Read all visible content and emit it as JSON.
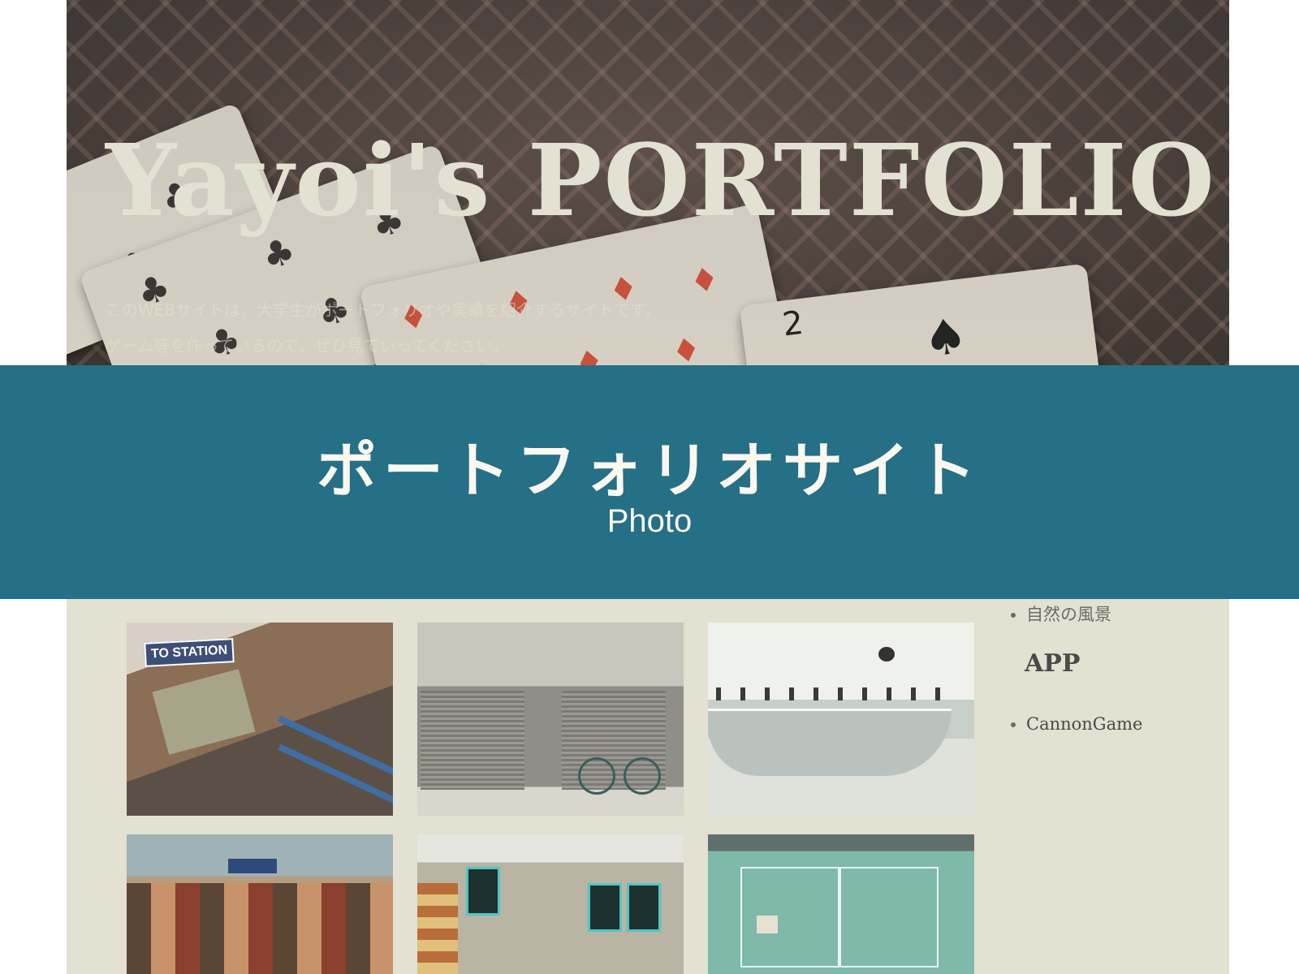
{
  "hero": {
    "title": "Yayoi's PORTFOLIO",
    "description": [
      "このWEBサイトは、大学生がポートフォリオや実績を紹介するサイトです。",
      "ゲーム等を作っているので、ぜひ見ていってください。"
    ]
  },
  "banner": {
    "title": "ポートフォリオサイト",
    "subtitle": "Photo"
  },
  "photos": {
    "sign_text": "TO STATION"
  },
  "sidebar": {
    "photo_items": [
      "自然の風景"
    ],
    "app_heading": "APP",
    "app_items": [
      "CannonGame"
    ]
  },
  "colors": {
    "banner_bg": "#256f87",
    "page_bg": "#e2e1d2",
    "hero_title": "#e2e1d2"
  }
}
